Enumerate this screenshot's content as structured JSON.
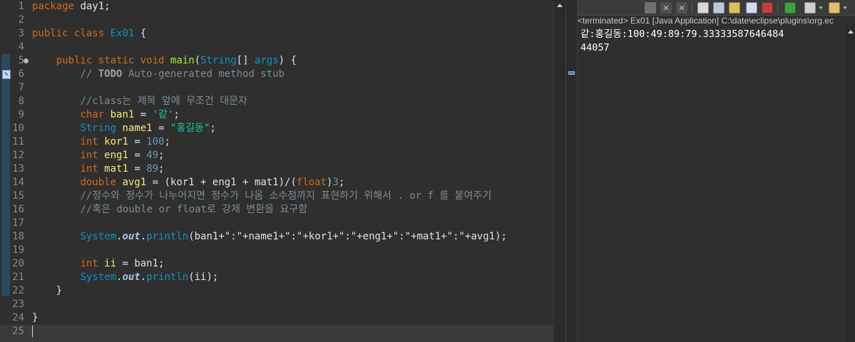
{
  "editor": {
    "line_numbers": [
      "1",
      "2",
      "3",
      "4",
      "5",
      "6",
      "7",
      "8",
      "9",
      "10",
      "11",
      "12",
      "13",
      "14",
      "15",
      "16",
      "17",
      "18",
      "19",
      "20",
      "21",
      "22",
      "23",
      "24",
      "25"
    ],
    "code": {
      "l1_kw": "package",
      "l1_rest": " day1;",
      "l3_kw1": "public",
      "l3_kw2": "class",
      "l3_cls": "Ex01",
      "l3_rest": " {",
      "l5_kw1": "public",
      "l5_kw2": "static",
      "l5_kw3": "void",
      "l5_mth": "main",
      "l5_type": "String",
      "l5_arr": "[] ",
      "l5_var": "args",
      "l5_rest": ") {",
      "l6_c1": "// ",
      "l6_todo": "TODO",
      "l6_c2": " Auto-generated method stub",
      "l8_cmt": "//class는 제목 앞에 무조건 대문자",
      "l9_kw": "char",
      "l9_var": "ban1",
      "l9_str": "'같'",
      "l10_type": "String",
      "l10_var": "name1",
      "l10_str": "\"홍길동\"",
      "l11_kw": "int",
      "l11_var": "kor1",
      "l11_num": "100",
      "l12_kw": "int",
      "l12_var": "eng1",
      "l12_num": "49",
      "l13_kw": "int",
      "l13_var": "mat1",
      "l13_num": "89",
      "l14_kw": "double",
      "l14_var": "avg1",
      "l14_mid": " = (kor1 + eng1 + mat1)/(",
      "l14_kw2": "float",
      "l14_num": "3",
      "l15_cmt": "//정수와 정수가 나누어지면 정수가 나옴 소수점까지 표현하기 위해서 . or f 를 붙여주기",
      "l16_cmt": "//혹은 double or float로 강제 변환을 요구함",
      "l18_cls": "System",
      "l18_out": "out",
      "l18_mth": "println",
      "l18_args": "(ban1+\":\"+name1+\":\"+kor1+\":\"+eng1+\":\"+mat1+\":\"+avg1);",
      "l20_kw": "int",
      "l20_var": "ii",
      "l20_rest": " = ban1;",
      "l21_cls": "System",
      "l21_out": "out",
      "l21_mth": "println",
      "l21_args": "(ii);",
      "l22": "}",
      "l24": "}"
    }
  },
  "console": {
    "header": "<terminated> Ex01 [Java Application] C:\\date\\eclipse\\plugins\\org.ec",
    "output_line1": "같:홍길동:100:49:89:79.33333587646484",
    "output_line2": "44057"
  },
  "toolbar_icons": [
    "terminate-icon",
    "remove-launch-icon",
    "remove-all-icon",
    "scroll-lock-icon",
    "word-wrap-icon",
    "show-on-stdout-icon",
    "show-on-stderr-icon",
    "pin-console-icon",
    "display-console-icon",
    "open-console-icon"
  ],
  "colors": {
    "keyword": "#cc6c1d",
    "type": "#1290c3",
    "string": "#17c6a3",
    "number": "#6897bb",
    "comment": "#7d8c93",
    "variable": "#f3ec79",
    "method": "#a7ec21"
  }
}
